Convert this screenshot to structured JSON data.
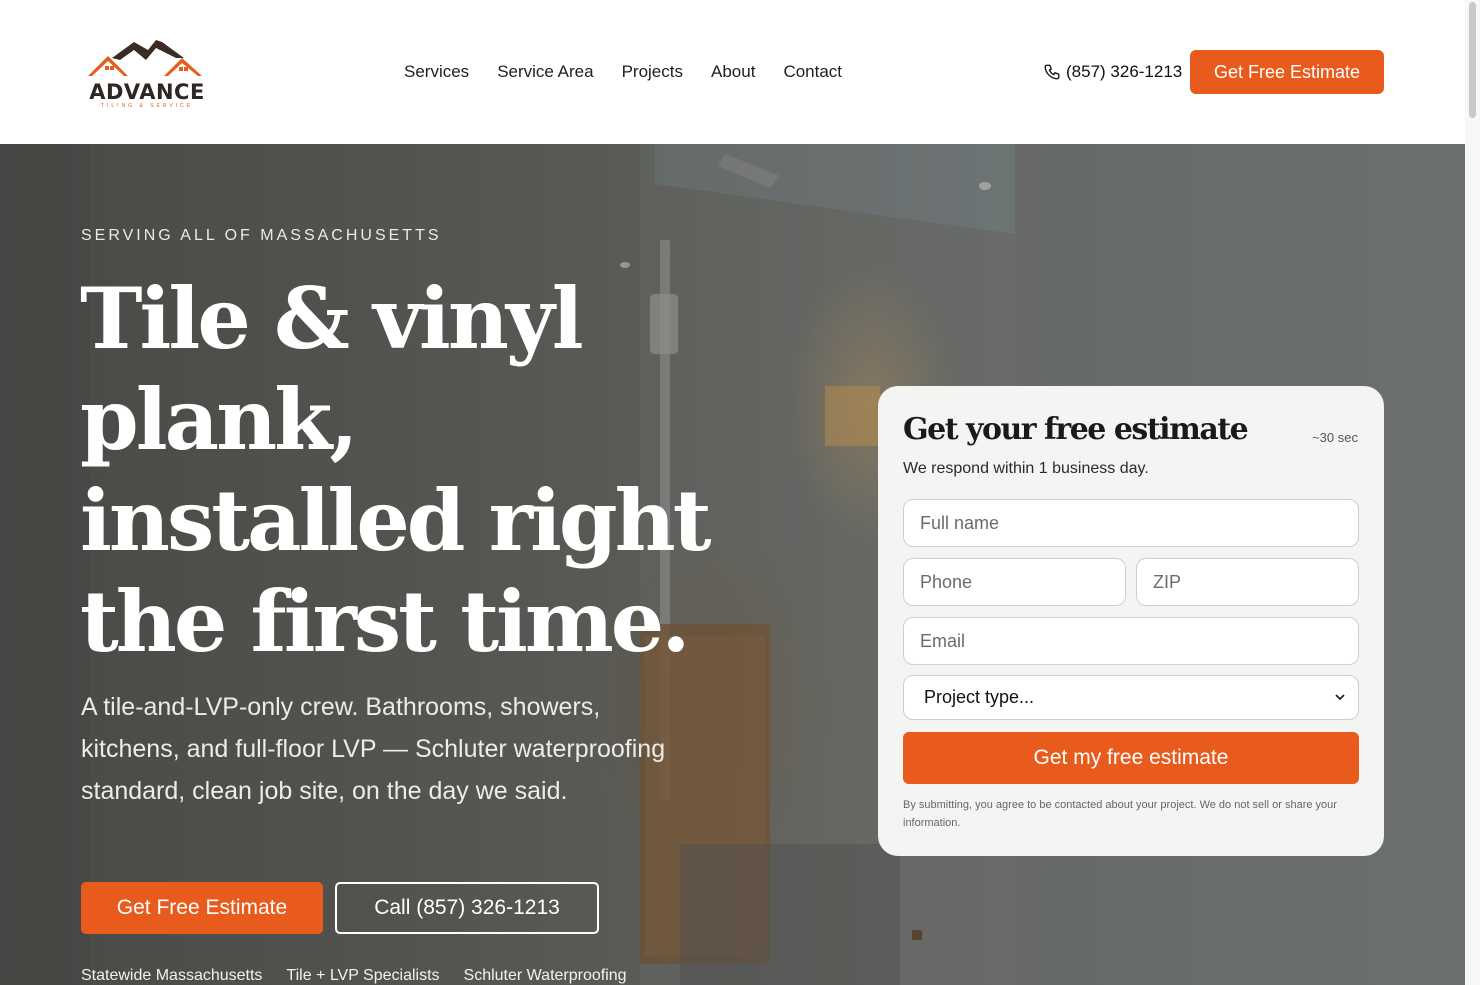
{
  "brand": {
    "name": "ADVANCE",
    "tagline": "TILING & SERVICE",
    "colors": {
      "accent": "#e85b1c",
      "dark": "#2e2623"
    }
  },
  "nav": {
    "items": [
      {
        "label": "Services"
      },
      {
        "label": "Service Area"
      },
      {
        "label": "Projects"
      },
      {
        "label": "About"
      },
      {
        "label": "Contact"
      }
    ]
  },
  "header": {
    "phone_icon": "phone-icon",
    "phone": "(857) 326-1213",
    "cta": "Get Free Estimate"
  },
  "hero": {
    "eyebrow": "SERVING ALL OF MASSACHUSETTS",
    "headline": "Tile & vinyl plank, installed right the first time.",
    "subtext": "A tile-and-LVP-only crew. Bathrooms, showers, kitchens, and full-floor LVP — Schluter waterproofing standard, clean job site, on the day we said.",
    "primary_cta": "Get Free Estimate",
    "secondary_cta": "Call (857) 326-1213",
    "badges": [
      "Statewide Massachusetts",
      "Tile + LVP Specialists",
      "Schluter Waterproofing"
    ]
  },
  "form": {
    "title": "Get your free estimate",
    "time_hint": "~30 sec",
    "response_note": "We respond within 1 business day.",
    "fields": {
      "full_name": {
        "placeholder": "Full name",
        "value": ""
      },
      "phone": {
        "placeholder": "Phone",
        "value": ""
      },
      "zip": {
        "placeholder": "ZIP",
        "value": ""
      },
      "email": {
        "placeholder": "Email",
        "value": ""
      }
    },
    "project_type": {
      "selected": "Project type..."
    },
    "submit": "Get my free estimate",
    "disclaimer": "By submitting, you agree to be contacted about your project. We do not sell or share your information."
  }
}
